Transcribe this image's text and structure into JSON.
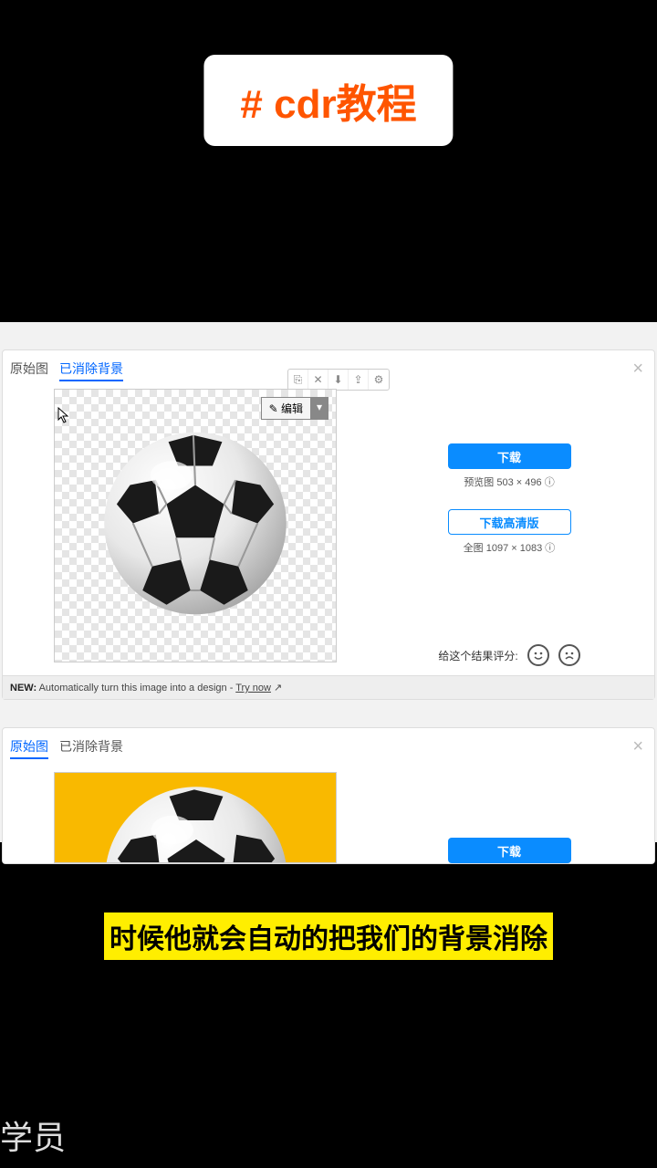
{
  "hashtag": "# cdr教程",
  "card1": {
    "tab_original": "原始图",
    "tab_removed": "已消除背景",
    "edit_button": "✎ 编辑",
    "download": "下载",
    "download_dim_label": "预览图",
    "download_dim": "503 × 496",
    "download_hd": "下载高清版",
    "hd_dim_label": "全图",
    "hd_dim": "1097 × 1083",
    "rating_label": "给这个结果评分:",
    "new_label": "NEW:",
    "new_text": "Automatically turn this image into a design -",
    "new_link": "Try now"
  },
  "card2": {
    "tab_original": "原始图",
    "tab_removed": "已消除背景",
    "download": "下载"
  },
  "caption": "时候他就会自动的把我们的背景消除",
  "watermark": "学员"
}
